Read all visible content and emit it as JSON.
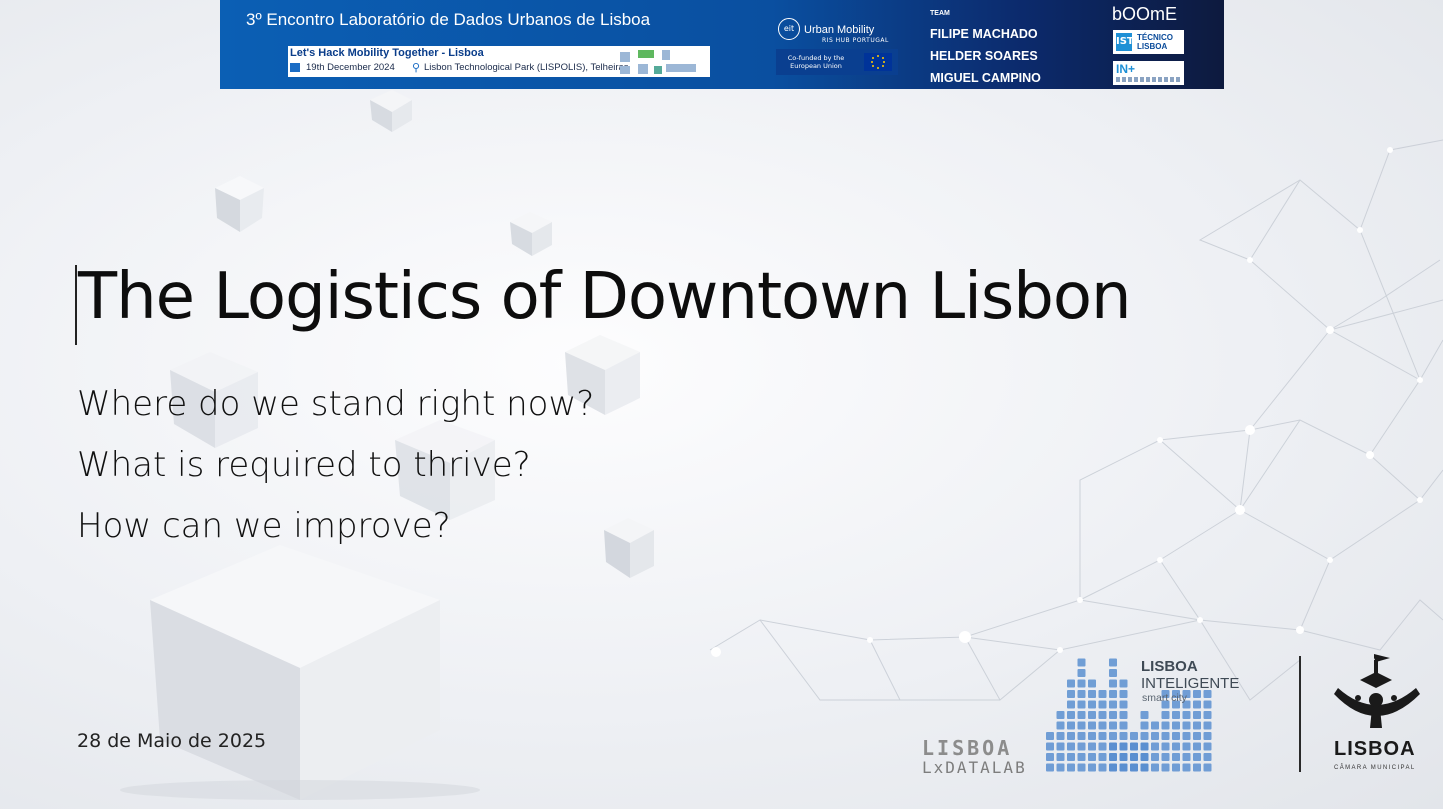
{
  "banner": {
    "event_title": "3º Encontro Laboratório de Dados Urbanos de Lisboa",
    "hack_title": "Let's Hack Mobility Together - Lisboa",
    "hack_date": "19th December 2024",
    "hack_venue": "Lisbon Technological Park (LISPOLIS), Telheiras",
    "eit_mark": "eit",
    "eit_name": "Urban Mobility",
    "eit_hub": "RIS HUB PORTUGAL",
    "cofunded": "Co-funded by the European Union",
    "team_label": "TEAM",
    "team": [
      "FILIPE MACHADO",
      "HELDER SOARES",
      "MIGUEL CAMPINO"
    ],
    "boome": "bOOmE",
    "tecnico_symbol": "IST",
    "tecnico_name": "TÉCNICO LISBOA",
    "inplus": "IN+"
  },
  "slide": {
    "title": "The Logistics of Downtown Lisbon",
    "questions": [
      "Where do we stand right now?",
      "What is required to thrive?",
      "How can we improve?"
    ],
    "date": "28 de Maio de 2025"
  },
  "footer": {
    "lxdatalab_top": "LISBOA",
    "lxdatalab_bottom": "LxDATALAB",
    "lisboa_inteligente_title": "LISBOA",
    "lisboa_inteligente_sub": "INTELIGENTE",
    "lisboa_inteligente_small": "smart city",
    "cml_name": "LISBOA",
    "cml_sub": "CÂMARA MUNICIPAL"
  },
  "colors": {
    "banner_blue": "#0b5fb4",
    "banner_dark": "#0d1a3e",
    "text": "#0d0d0d",
    "logo_blue": "#5b8fd0"
  }
}
